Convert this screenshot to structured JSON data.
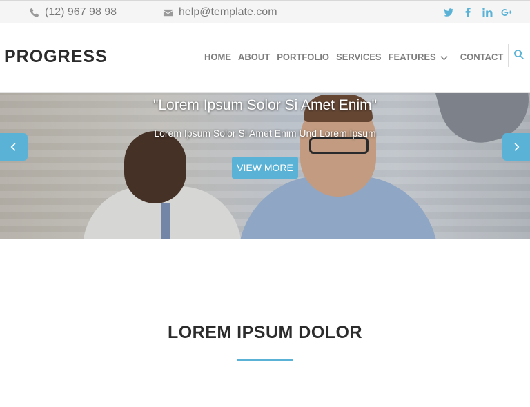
{
  "topbar": {
    "phone": "(12) 967 98 98",
    "email": "help@template.com",
    "social": [
      "twitter-icon",
      "facebook-icon",
      "linkedin-icon",
      "google-plus-icon"
    ]
  },
  "header": {
    "logo": "PROGRESS",
    "nav": [
      {
        "label": "HOME"
      },
      {
        "label": "ABOUT"
      },
      {
        "label": "PORTFOLIO"
      },
      {
        "label": "SERVICES"
      },
      {
        "label": "FEATURES",
        "dropdown": true
      },
      {
        "label": "CONTACT"
      }
    ],
    "search_icon": "search-icon"
  },
  "hero": {
    "title": "\"Lorem Ipsum Solor Si Amet Enim\"",
    "subtitle": "Lorem Ipsum Solor Si Amet Enim Und Lorem Ipsum",
    "button": "VIEW MORE",
    "prev_icon": "chevron-left-icon",
    "next_icon": "chevron-right-icon"
  },
  "section": {
    "title": "LOREM IPSUM DOLOR"
  },
  "colors": {
    "accent": "#5ab3d6",
    "topbar_bg": "#f5f5f5",
    "nav_text": "#7d7d7d",
    "logo_text": "#2c2c2c"
  }
}
